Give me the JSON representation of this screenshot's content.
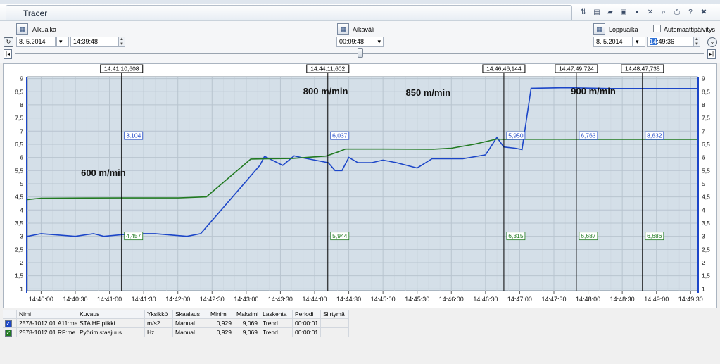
{
  "window": {
    "title": "Tracer"
  },
  "toolbar": {
    "icons": [
      "cursor-settings-icon",
      "layout-icon",
      "open-folder-icon",
      "save-icon",
      "disk-icon",
      "close-icon",
      "zoom-icon",
      "print-icon",
      "help-icon",
      "close-window-icon"
    ]
  },
  "start": {
    "label": "Alkuaika",
    "date": "8. 5.2014",
    "time": "14:39:48"
  },
  "interval": {
    "label": "Aikaväli",
    "value": "00:09:48"
  },
  "end": {
    "label": "Loppuaika",
    "date": "8. 5.2014",
    "time_highlight": "14",
    "time_rest": ":49:36",
    "auto_update_label": "Automaattipäivitys"
  },
  "chart_data": {
    "type": "line",
    "x_ticks": [
      "14:40:00",
      "14:40:30",
      "14:41:00",
      "14:41:30",
      "14:42:00",
      "14:42:30",
      "14:43:00",
      "14:43:30",
      "14:44:00",
      "14:44:30",
      "14:45:00",
      "14:45:30",
      "14:46:00",
      "14:46:30",
      "14:47:00",
      "14:47:30",
      "14:48:00",
      "14:48:30",
      "14:49:00",
      "14:49:30"
    ],
    "y_ticks": [
      "1",
      "1,5",
      "2",
      "2,5",
      "3",
      "3,5",
      "4",
      "4,5",
      "5",
      "5,5",
      "6",
      "6,5",
      "7",
      "7,5",
      "8",
      "8,5",
      "9"
    ],
    "ylim": [
      0.929,
      9.069
    ],
    "xlim_seconds": [
      2388,
      2976
    ],
    "series": [
      {
        "color": "#1c46c8",
        "points": [
          [
            2388,
            3.0
          ],
          [
            2400,
            3.1
          ],
          [
            2430,
            3.0
          ],
          [
            2446,
            3.1
          ],
          [
            2455,
            3.0
          ],
          [
            2480,
            3.1
          ],
          [
            2500,
            3.1
          ],
          [
            2528,
            3.0
          ],
          [
            2540,
            3.1
          ],
          [
            2592,
            5.7
          ],
          [
            2596,
            6.04
          ],
          [
            2612,
            5.7
          ],
          [
            2622,
            6.06
          ],
          [
            2628,
            6.0
          ],
          [
            2640,
            5.9
          ],
          [
            2652,
            5.8
          ],
          [
            2658,
            5.5
          ],
          [
            2664,
            5.5
          ],
          [
            2670,
            6.0
          ],
          [
            2678,
            5.8
          ],
          [
            2690,
            5.8
          ],
          [
            2700,
            5.9
          ],
          [
            2712,
            5.8
          ],
          [
            2730,
            5.6
          ],
          [
            2743,
            5.95
          ],
          [
            2756,
            5.95
          ],
          [
            2770,
            5.95
          ],
          [
            2790,
            6.1
          ],
          [
            2800,
            6.76
          ],
          [
            2806,
            6.4
          ],
          [
            2816,
            6.35
          ],
          [
            2822,
            6.3
          ],
          [
            2830,
            8.63
          ],
          [
            2860,
            8.65
          ],
          [
            2900,
            8.62
          ],
          [
            2976,
            8.62
          ]
        ]
      },
      {
        "color": "#217a21",
        "points": [
          [
            2388,
            4.4
          ],
          [
            2400,
            4.45
          ],
          [
            2440,
            4.457
          ],
          [
            2470,
            4.46
          ],
          [
            2520,
            4.46
          ],
          [
            2545,
            4.5
          ],
          [
            2584,
            5.94
          ],
          [
            2600,
            5.95
          ],
          [
            2620,
            5.96
          ],
          [
            2650,
            6.05
          ],
          [
            2660,
            6.2
          ],
          [
            2667,
            6.32
          ],
          [
            2700,
            6.32
          ],
          [
            2744,
            6.315
          ],
          [
            2760,
            6.35
          ],
          [
            2780,
            6.5
          ],
          [
            2800,
            6.7
          ],
          [
            2806,
            6.687
          ],
          [
            2820,
            6.69
          ],
          [
            2857,
            6.69
          ],
          [
            2880,
            6.686
          ],
          [
            2976,
            6.686
          ]
        ]
      }
    ],
    "cursors": [
      {
        "time": "14:41:10,608",
        "t": 2470.6,
        "top": "3,104",
        "bottom": "4,457"
      },
      {
        "time": "14:44:11,602",
        "t": 2651.6,
        "top": "6,037",
        "bottom": "5,944"
      },
      {
        "time": "14:46:46,144",
        "t": 2806.1,
        "top": "5,950",
        "bottom": "6,315"
      },
      {
        "time": "14:47:49,724",
        "t": 2869.7,
        "top": "6,763",
        "bottom": "6,687"
      },
      {
        "time": "14:48:47,735",
        "t": 2927.7,
        "top": "8,632",
        "bottom": "6,686"
      }
    ],
    "annotations": [
      {
        "text": "600 m/min",
        "t": 2435,
        "y": 5.3
      },
      {
        "text": "800 m/min",
        "t": 2630,
        "y": 8.4
      },
      {
        "text": "850 m/min",
        "t": 2720,
        "y": 8.35
      },
      {
        "text": "900 m/min",
        "t": 2865,
        "y": 8.4
      }
    ]
  },
  "table": {
    "headers": [
      "Nimi",
      "Kuvaus",
      "Yksikkö",
      "Skaalaus",
      "Minimi",
      "Maksimi",
      "Laskenta",
      "Periodi",
      "Siirtymä"
    ],
    "rows": [
      {
        "color": "#1c46c8",
        "cells": [
          "2578-1012.01.A11:me",
          "STA HF piikki",
          "m/s2",
          "Manual",
          "0,929",
          "9,069",
          "Trend",
          "00:00:01",
          ""
        ]
      },
      {
        "color": "#217a21",
        "cells": [
          "2578-1012.01.RF:me",
          "Pyörimistaajuus",
          "Hz",
          "Manual",
          "0,929",
          "9,069",
          "Trend",
          "00:00:01",
          ""
        ]
      }
    ]
  }
}
